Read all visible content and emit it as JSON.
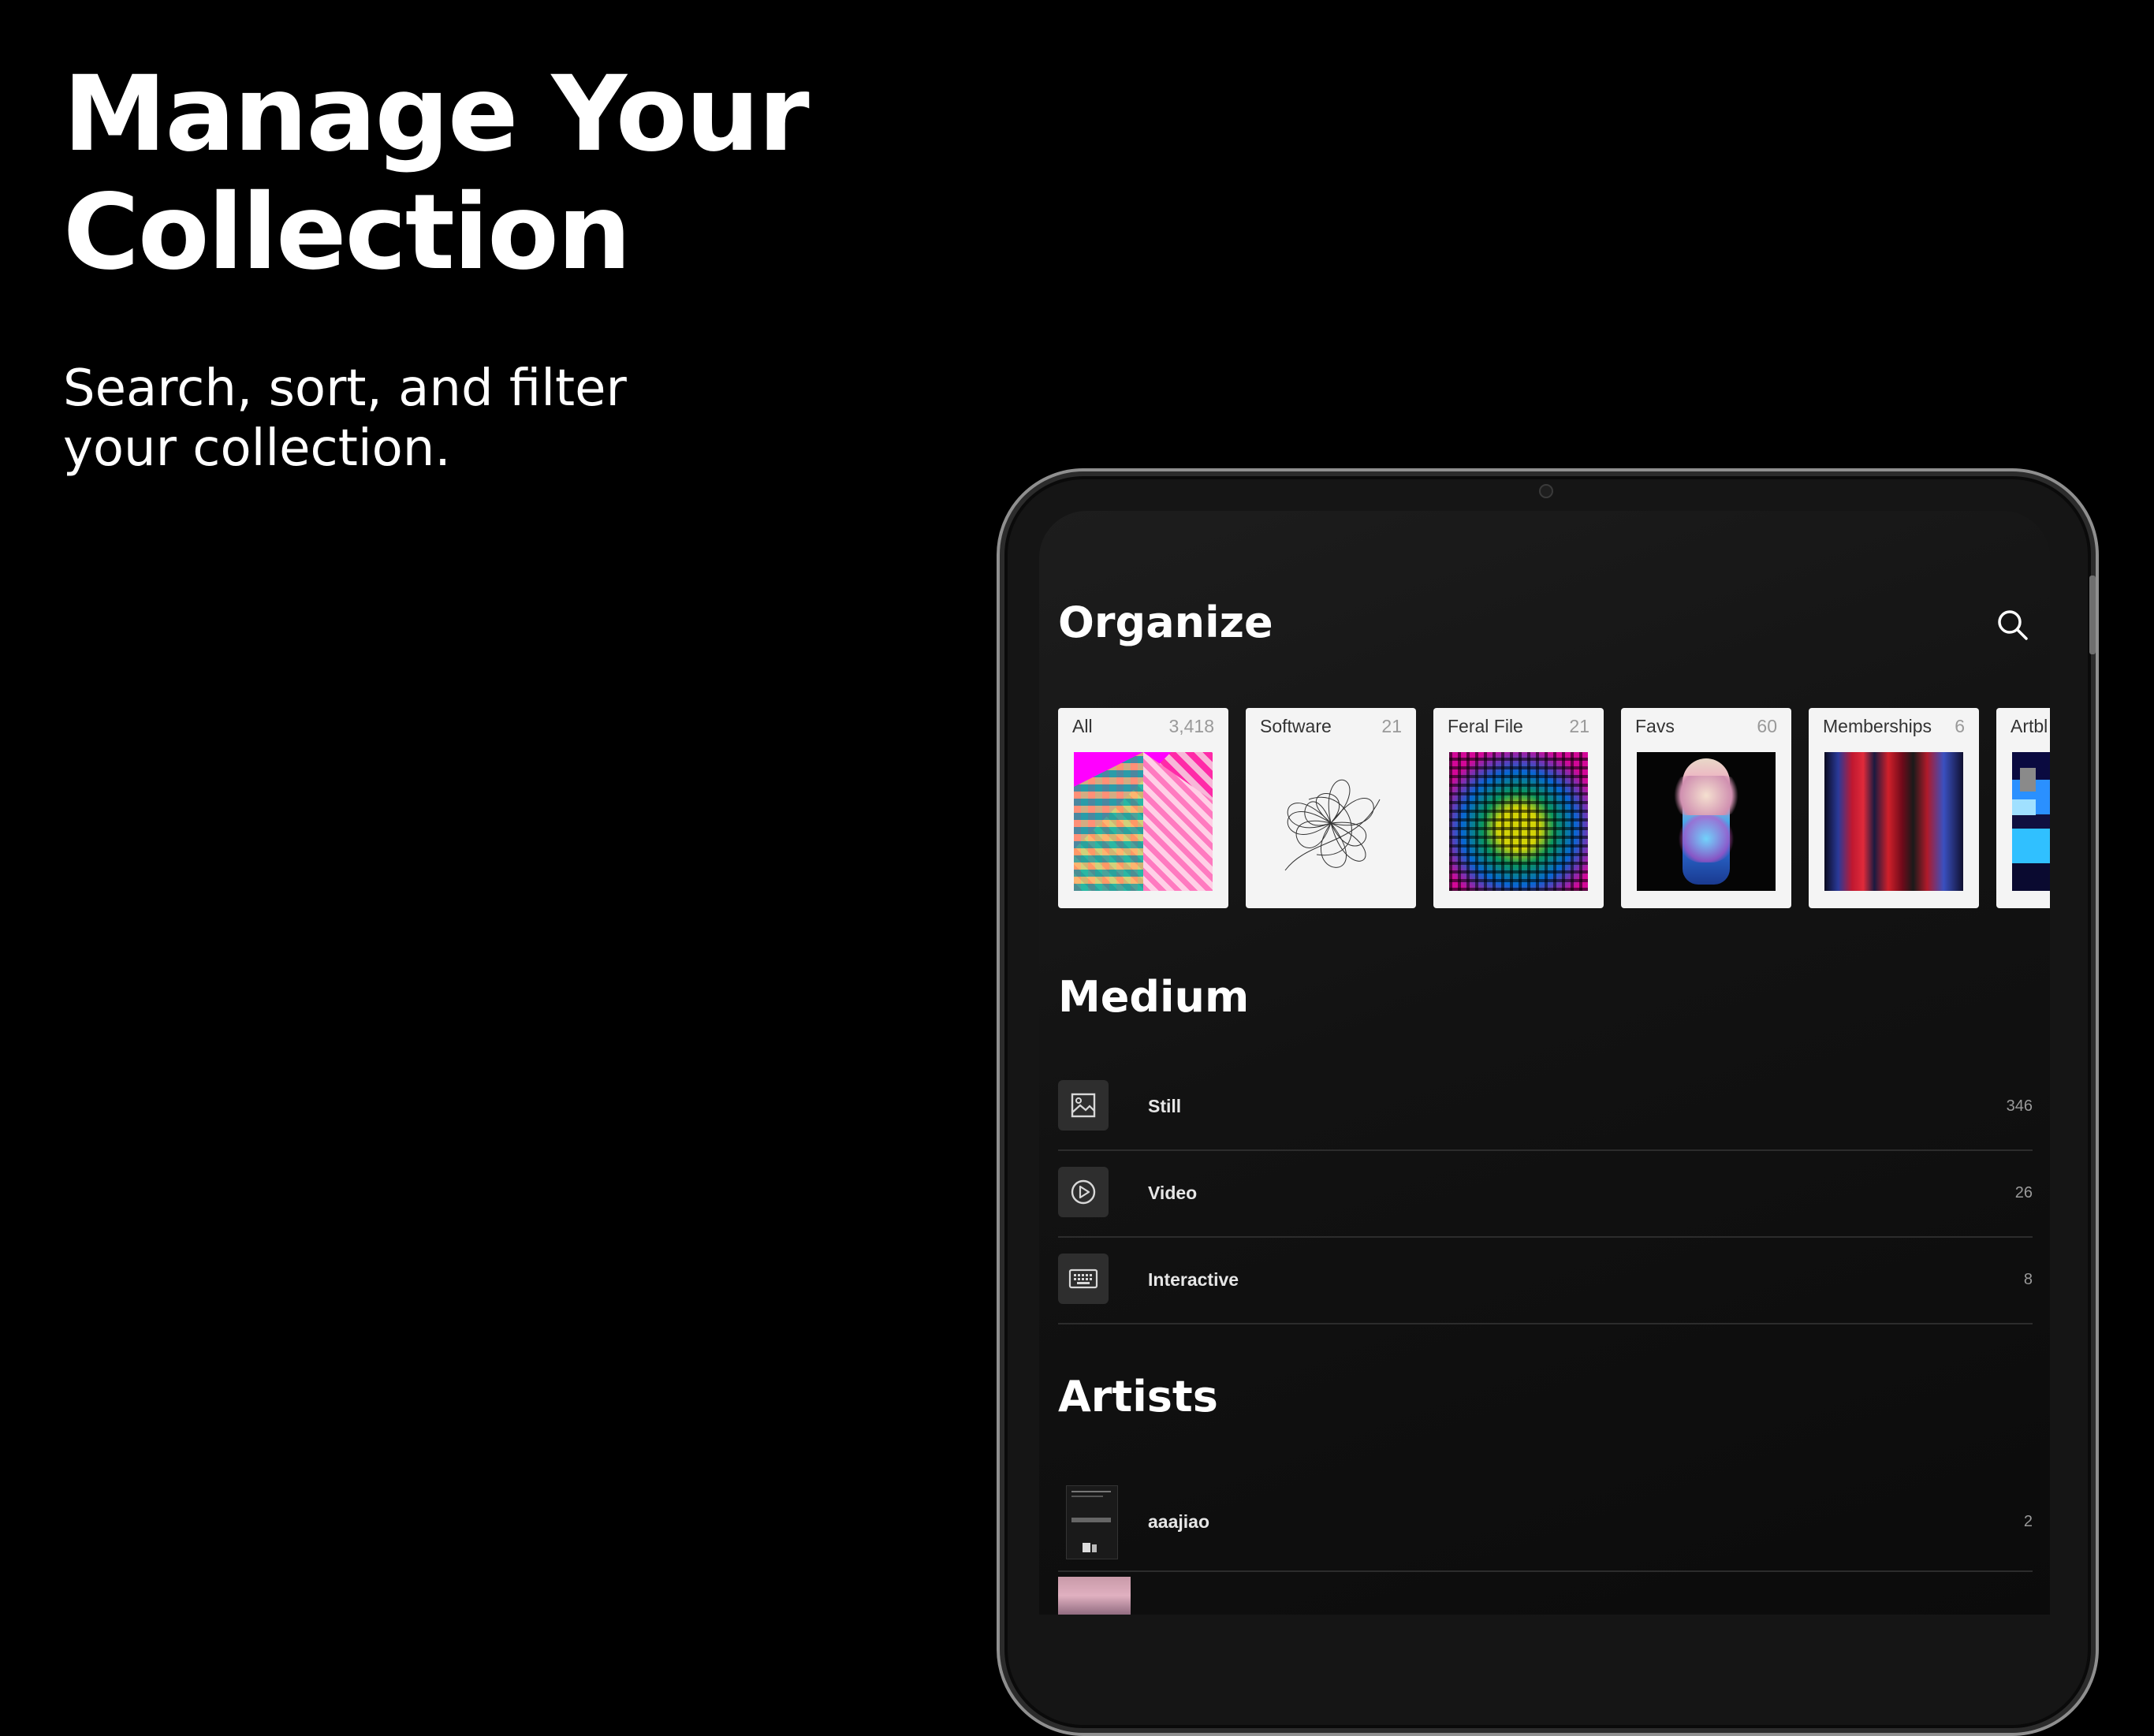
{
  "hero": {
    "title": "Manage Your Collection",
    "subtitle": "Search, sort, and filter your collection."
  },
  "screen": {
    "title": "Organize",
    "search_icon": "search-icon",
    "albums": [
      {
        "label": "All",
        "count": "3,418"
      },
      {
        "label": "Software",
        "count": "21"
      },
      {
        "label": "Feral File",
        "count": "21"
      },
      {
        "label": "Favs",
        "count": "60"
      },
      {
        "label": "Memberships",
        "count": "6"
      },
      {
        "label": "Artbl",
        "count": ""
      }
    ],
    "medium": {
      "title": "Medium",
      "items": [
        {
          "label": "Still",
          "count": "346",
          "icon": "image-icon"
        },
        {
          "label": "Video",
          "count": "26",
          "icon": "play-icon"
        },
        {
          "label": "Interactive",
          "count": "8",
          "icon": "keyboard-icon"
        }
      ]
    },
    "artists": {
      "title": "Artists",
      "items": [
        {
          "label": "aaajiao",
          "count": "2"
        },
        {
          "label": "",
          "count": ""
        }
      ]
    }
  },
  "colors": {
    "background": "#000000",
    "screen": "#151515",
    "card": "#f4f4f4",
    "divider": "#2c2c2c",
    "text": "#ffffff"
  }
}
